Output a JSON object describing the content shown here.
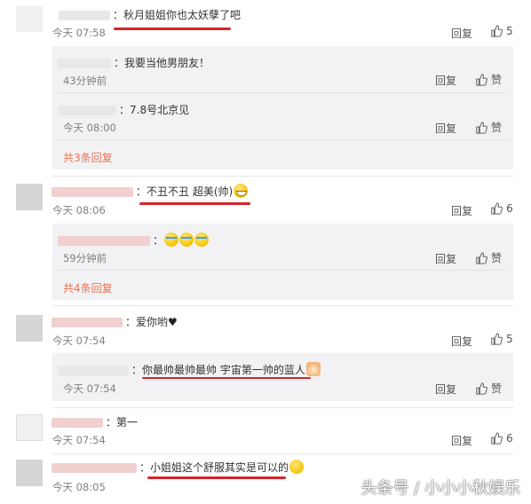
{
  "comments": [
    {
      "text": "秋月姐姐你也太妖孽了吧",
      "time": "今天 07:58",
      "reply_label": "回复",
      "likes": "5",
      "replies": [
        {
          "text": "我要当他男朋友！",
          "time": "43分钟前",
          "reply_label": "回复",
          "like_label": "赞"
        },
        {
          "text": "7.8号北京见",
          "time": "今天 08:00",
          "reply_label": "回复",
          "like_label": "赞"
        }
      ],
      "more": "共3条回复"
    },
    {
      "text": "不丑不丑 超美(帅)",
      "time": "今天 08:06",
      "reply_label": "回复",
      "likes": "6",
      "replies": [
        {
          "text": "",
          "time": "59分钟前",
          "reply_label": "回复",
          "like_label": "赞"
        }
      ],
      "more": "共4条回复"
    },
    {
      "text": "爱你哟",
      "time": "今天 07:54",
      "reply_label": "回复",
      "likes": "5",
      "replies": [
        {
          "text": "你最帅最帅最帅  宇宙第一帅的蓝人",
          "time": "今天 07:54",
          "reply_label": "回复",
          "like_label": "赞"
        }
      ]
    },
    {
      "text": "第一",
      "time": "今天 07:54",
      "reply_label": "回复",
      "likes": "6"
    },
    {
      "text": "小姐姐这个舒服其实是可以的",
      "time": "今天 08:05"
    }
  ],
  "watermark": "头条号 / 小小小秋娱乐",
  "colors": {
    "underline": "#d8232a",
    "more_link": "#eb7350",
    "sub_bg": "#f2f2f5"
  }
}
